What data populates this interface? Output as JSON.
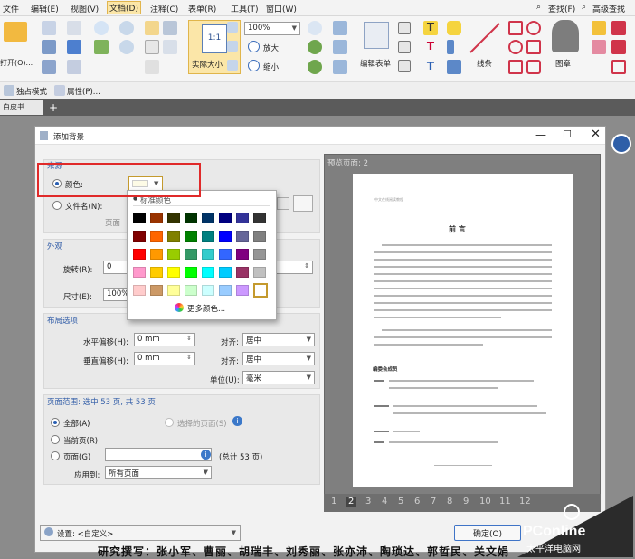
{
  "menubar": {
    "items": [
      "文件",
      "编辑(E)",
      "视图(V)",
      "文档(D)",
      "注释(C)",
      "表单(R)",
      "工具(T)",
      "窗口(W)"
    ],
    "right": [
      "查找(F)",
      "高级查找"
    ]
  },
  "ribbon": {
    "open_label": "打开(O)...",
    "actual_size": "实际大小",
    "zoom_value": "100%",
    "zoom_in": "放大",
    "zoom_out": "缩小",
    "edit_form": "编辑表单",
    "line": "线条",
    "stamp": "图章"
  },
  "bar2": {
    "standalone": "独占模式",
    "properties": "属性(P)..."
  },
  "doc_tab": "白皮书",
  "dialog": {
    "title": "添加背景",
    "source_title": "来源",
    "color_label": "颜色:",
    "file_label": "文件名(N):",
    "page_label": "页面",
    "appearance_title": "外观",
    "rotation_label": "旋转(R):",
    "rotation_value": "0",
    "size_label": "尺寸(E):",
    "size_value": "100%",
    "layout_title": "布局选项",
    "hoffset_label": "水平偏移(H):",
    "hoffset_value": "0 mm",
    "voffset_label": "垂直偏移(H):",
    "voffset_value": "0 mm",
    "align_label": "对齐:",
    "align_h_value": "居中",
    "align_v_label": "对齐:",
    "align_v_value": "居中",
    "unit_label": "单位(U):",
    "unit_value": "毫米",
    "range_title": "页面范围: 选中 53 页, 共 53 页",
    "all_pages": "全部(A)",
    "selected_pages": "选择的页面(S)",
    "current_page": "当前页(R)",
    "pages_label": "页面(G)",
    "total_pages": "(总计 53 页)",
    "apply_to_label": "应用到:",
    "apply_to_value": "所有页面",
    "settings_label": "设置: <自定义>",
    "ok_label": "确定(O)",
    "preview_title": "预览页面: 2"
  },
  "palette": {
    "header": "标准颜色",
    "more_colors": "更多颜色...",
    "rows": [
      [
        "#000000",
        "#993300",
        "#333300",
        "#003300",
        "#003366",
        "#000080",
        "#333399",
        "#333333"
      ],
      [
        "#800000",
        "#ff6600",
        "#808000",
        "#008000",
        "#008080",
        "#0000ff",
        "#666699",
        "#808080"
      ],
      [
        "#ff0000",
        "#ff9900",
        "#99cc00",
        "#339966",
        "#33cccc",
        "#3366ff",
        "#800080",
        "#969696"
      ],
      [
        "#ff99cc",
        "#ffcc00",
        "#ffff00",
        "#00ff00",
        "#00ffff",
        "#00ccff",
        "#993366",
        "#c0c0c0"
      ],
      [
        "#ffcccc",
        "#cc9966",
        "#ffff99",
        "#ccffcc",
        "#ccffff",
        "#99ccff",
        "#cc99ff",
        "#ffffff"
      ]
    ]
  },
  "preview_page": {
    "header_small": "中文在线阅读教程",
    "heading": "前 言",
    "editor_title": "编委会成员"
  },
  "pager": [
    "1",
    "2",
    "3",
    "4",
    "5",
    "6",
    "7",
    "8",
    "9",
    "10",
    "11",
    "12"
  ],
  "bottom_text": "研究撰写：张小军、曹丽、胡瑞丰、刘秀丽、张亦沛、陶琐达、郭哲民、关文娟",
  "watermark": {
    "brand": "PConline",
    "tagline": "太平洋电脑网"
  }
}
